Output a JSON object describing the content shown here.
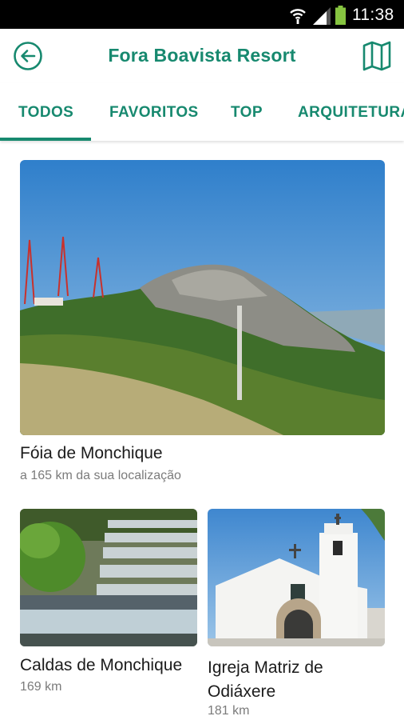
{
  "status_bar": {
    "time": "11:38",
    "icons": [
      "wifi-icon",
      "signal-icon",
      "battery-icon"
    ]
  },
  "app_bar": {
    "title": "Fora Boavista Resort",
    "back_icon": "arrow-left-circle-icon",
    "map_icon": "map-icon"
  },
  "tabs": [
    {
      "label": "TODOS",
      "active": true
    },
    {
      "label": "FAVORITOS",
      "active": false
    },
    {
      "label": "TOP",
      "active": false
    },
    {
      "label": "ARQUITETURA",
      "active": false
    }
  ],
  "places": [
    {
      "name": "Fóia de Monchique",
      "distance": "a 165 km da sua localização"
    },
    {
      "name": "Caldas de Monchique",
      "distance": "169 km"
    },
    {
      "name": "Igreja Matriz de Odiáxere",
      "distance": "181 km"
    }
  ],
  "colors": {
    "accent": "#17896f",
    "status_bar": "#000000"
  }
}
